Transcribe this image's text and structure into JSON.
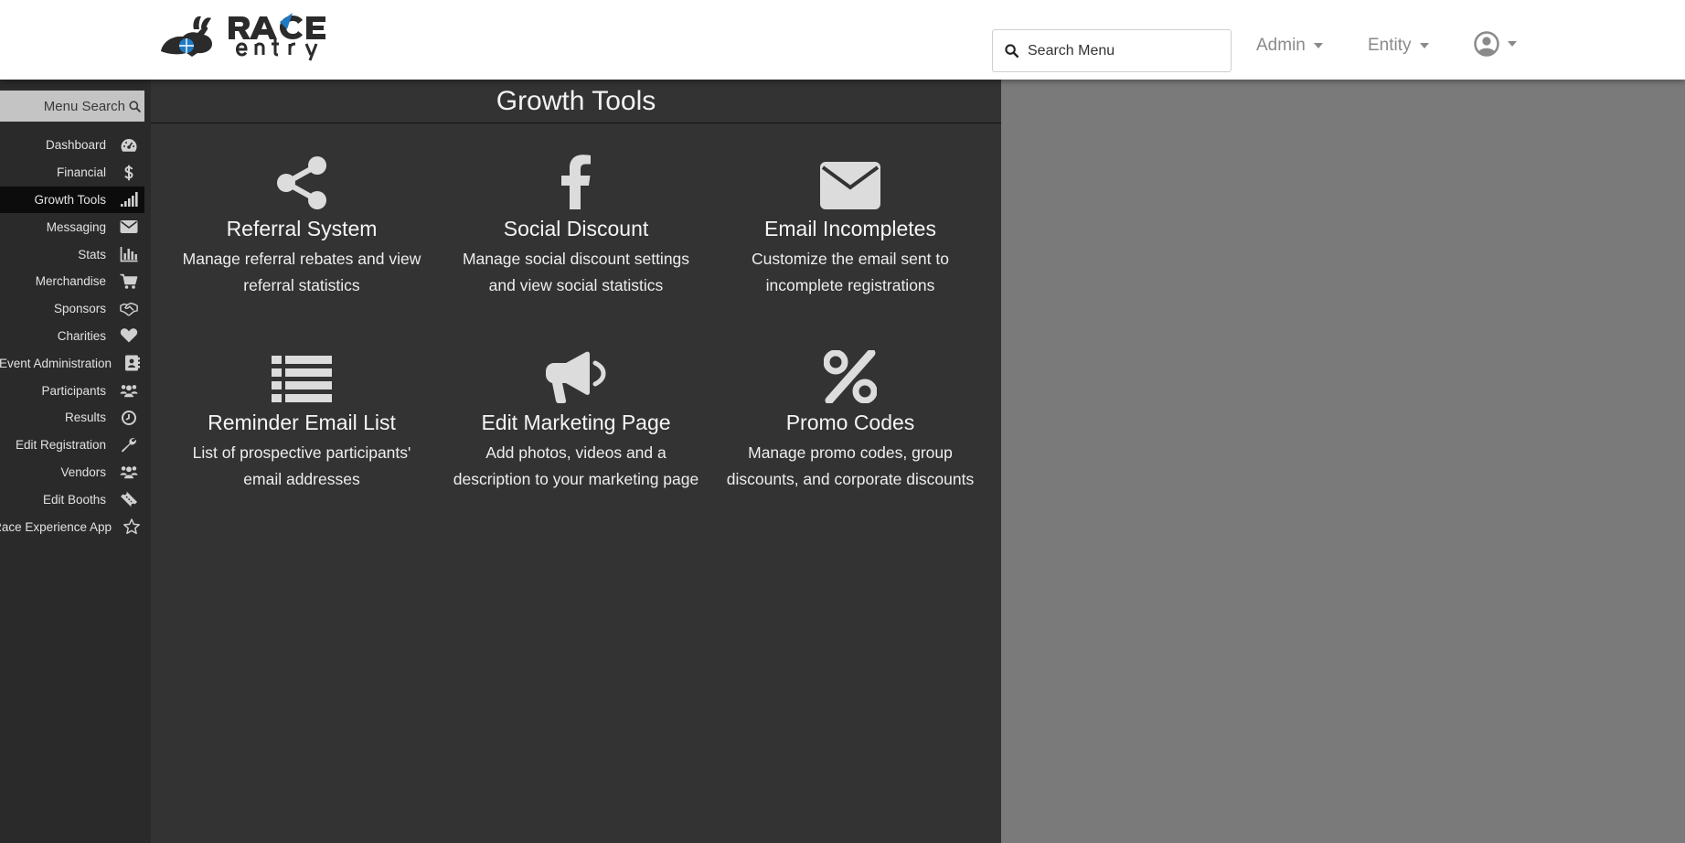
{
  "header": {
    "search_placeholder": "Search Menu",
    "admin_label": "Admin",
    "entity_label": "Entity",
    "brand_colors": {
      "dark": "#2b2b2b",
      "blue": "#1f7ac4"
    }
  },
  "sidebar": {
    "menu_search_label": "Menu Search",
    "items": [
      {
        "label": "Dashboard",
        "icon": "dashboard-icon"
      },
      {
        "label": "Financial",
        "icon": "dollar-icon"
      },
      {
        "label": "Growth Tools",
        "icon": "signal-icon",
        "active": true
      },
      {
        "label": "Messaging",
        "icon": "envelope-icon"
      },
      {
        "label": "Stats",
        "icon": "bar-chart-icon"
      },
      {
        "label": "Merchandise",
        "icon": "cart-icon"
      },
      {
        "label": "Sponsors",
        "icon": "handshake-icon"
      },
      {
        "label": "Charities",
        "icon": "heart-icon"
      },
      {
        "label": "Event Administration",
        "icon": "address-book-icon"
      },
      {
        "label": "Participants",
        "icon": "users-icon"
      },
      {
        "label": "Results",
        "icon": "clock-icon"
      },
      {
        "label": "Edit Registration",
        "icon": "wrench-icon"
      },
      {
        "label": "Vendors",
        "icon": "users-icon"
      },
      {
        "label": "Edit Booths",
        "icon": "ticket-icon"
      },
      {
        "label": "Race Experience App",
        "icon": "star-icon"
      }
    ]
  },
  "main": {
    "title": "Growth Tools",
    "tiles": [
      {
        "title": "Referral System",
        "description": "Manage referral rebates and view referral statistics",
        "icon": "share-icon"
      },
      {
        "title": "Social Discount",
        "description": "Manage social discount settings and view social statistics",
        "icon": "facebook-icon"
      },
      {
        "title": "Email Incompletes",
        "description": "Customize the email sent to incomplete registrations",
        "icon": "envelope-icon"
      },
      {
        "title": "Reminder Email List",
        "description": "List of prospective participants' email addresses",
        "icon": "list-icon"
      },
      {
        "title": "Edit Marketing Page",
        "description": "Add photos, videos and a description to your marketing page",
        "icon": "megaphone-icon"
      },
      {
        "title": "Promo Codes",
        "description": "Manage promo codes, group discounts, and corporate discounts",
        "icon": "percent-icon"
      }
    ]
  }
}
